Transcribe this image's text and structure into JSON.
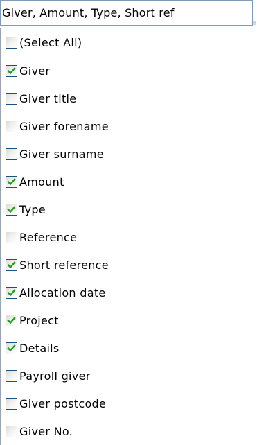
{
  "combo": {
    "value": "Giver, Amount, Type, Short ref"
  },
  "colors": {
    "checkmark": "#21a121",
    "checkbox_border": "#1c5180",
    "field_border": "#7f9db9"
  },
  "options": [
    {
      "label": "(Select All)",
      "checked": false
    },
    {
      "label": "Giver",
      "checked": true
    },
    {
      "label": "Giver title",
      "checked": false
    },
    {
      "label": "Giver forename",
      "checked": false
    },
    {
      "label": "Giver surname",
      "checked": false
    },
    {
      "label": "Amount",
      "checked": true
    },
    {
      "label": "Type",
      "checked": true
    },
    {
      "label": "Reference",
      "checked": false
    },
    {
      "label": "Short reference",
      "checked": true
    },
    {
      "label": "Allocation date",
      "checked": true
    },
    {
      "label": "Project",
      "checked": true
    },
    {
      "label": "Details",
      "checked": true
    },
    {
      "label": "Payroll giver",
      "checked": false
    },
    {
      "label": "Giver postcode",
      "checked": false
    },
    {
      "label": "Giver No.",
      "checked": false
    }
  ]
}
